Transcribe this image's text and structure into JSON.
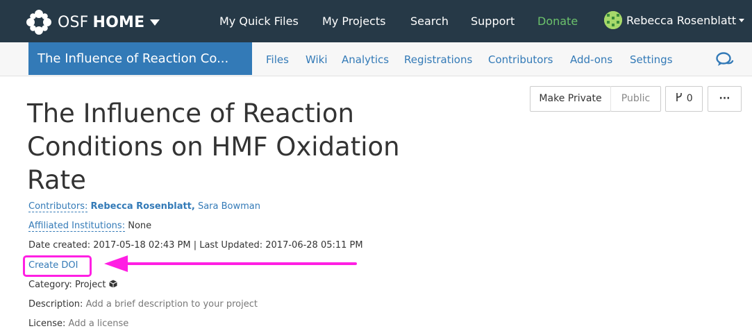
{
  "topnav": {
    "brand_osf": "OSF",
    "brand_home": "HOME",
    "links": [
      "My Quick Files",
      "My Projects",
      "Search",
      "Support",
      "Donate"
    ],
    "user_name": "Rebecca Rosenblatt",
    "icons": {
      "brand": "osf-logo-icon",
      "user": "avatar",
      "menu": "caret-down-icon"
    },
    "colors": {
      "background": "#263947",
      "donate": "#6cc26c"
    }
  },
  "projnav": {
    "title": "The Influence of Reaction Co...",
    "tabs": [
      "Files",
      "Wiki",
      "Analytics",
      "Registrations",
      "Contributors",
      "Add-ons",
      "Settings"
    ],
    "chat_icon": "comments-icon",
    "colors": {
      "title_bg": "#337ab7"
    }
  },
  "actions": {
    "make_private": "Make Private",
    "public": "Public",
    "forks_count": "0",
    "more": "···"
  },
  "project": {
    "title": "The Influence of Reaction Conditions on HMF Oxidation Rate",
    "contributors_label": "Contributors:",
    "contributors": [
      "Rebecca Rosenblatt,",
      "Sara Bowman"
    ],
    "affiliated_label": "Affiliated Institutions:",
    "affiliated_value": "None",
    "dates": "Date created: 2017-05-18 02:43 PM | Last Updated: 2017-06-28 05:11 PM",
    "create_doi": "Create DOI",
    "category_label": "Category:",
    "category_value": "Project",
    "description_label": "Description:",
    "description_value": "Add a brief description to your project",
    "license_label": "License:",
    "license_value": "Add a license"
  },
  "annotation": {
    "color": "#ff1fe3"
  }
}
